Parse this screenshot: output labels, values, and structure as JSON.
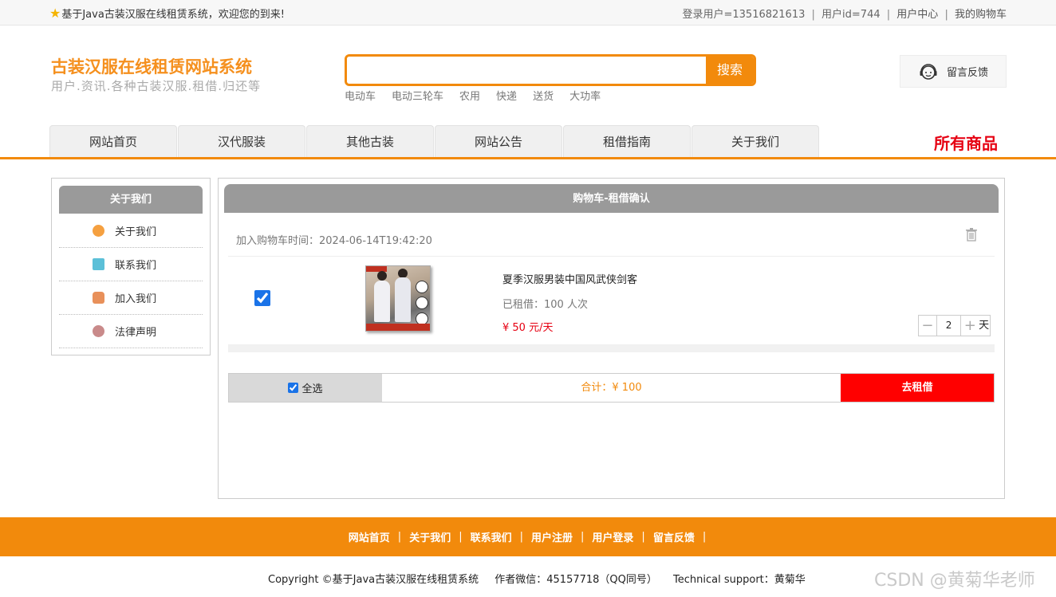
{
  "topbar": {
    "welcome": "基于Java古装汉服在线租赁系统，欢迎您的到来!",
    "login_user": "登录用户=13516821613",
    "user_id": "用户id=744",
    "user_center": "用户中心",
    "my_cart": "我的购物车",
    "separator": "|"
  },
  "header": {
    "logo_title": "古装汉服在线租赁网站系统",
    "logo_sub": "用户.资讯.各种古装汉服.租借.归还等",
    "search_placeholder": "",
    "search_button": "搜索",
    "hotwords": [
      "电动车",
      "电动三轮车",
      "农用",
      "快递",
      "送货",
      "大功率"
    ],
    "feedback": "留言反馈"
  },
  "nav": {
    "tabs": [
      "网站首页",
      "汉代服装",
      "其他古装",
      "网站公告",
      "租借指南",
      "关于我们"
    ],
    "all_goods": "所有商品"
  },
  "sidebar": {
    "title": "关于我们",
    "items": [
      {
        "label": "关于我们",
        "icon": "orange-circle-icon",
        "color": "#f5a040"
      },
      {
        "label": "联系我们",
        "icon": "clipboard-icon",
        "color": "#5cc0d8"
      },
      {
        "label": "加入我们",
        "icon": "lock-icon",
        "color": "#e8905a"
      },
      {
        "label": "法律声明",
        "icon": "power-icon",
        "color": "#c98a8a"
      }
    ]
  },
  "cart": {
    "title": "购物车-租借确认",
    "time_label": "加入购物车时间：2024-06-14T19:42:20",
    "item": {
      "name": "夏季汉服男装中国风武侠剑客",
      "rented": "已租借：100 人次",
      "price": "¥ 50 元/天",
      "qty": "2",
      "unit": "天",
      "checked": true
    },
    "select_all": "全选",
    "total": "合计：¥ 100",
    "checkout": "去租借"
  },
  "footer": {
    "links": [
      "网站首页",
      "关于我们",
      "联系我们",
      "用户注册",
      "用户登录",
      "留言反馈"
    ],
    "separator": "|",
    "copyright": "Copyright ©基于Java古装汉服在线租赁系统",
    "author": "作者微信：45157718（QQ同号）",
    "support": "Technical support：黄菊华",
    "watermark": "CSDN @黄菊华老师"
  },
  "colors": {
    "accent": "#f28a0c",
    "danger": "#ff0000",
    "header_gray": "#9a9a9a"
  }
}
